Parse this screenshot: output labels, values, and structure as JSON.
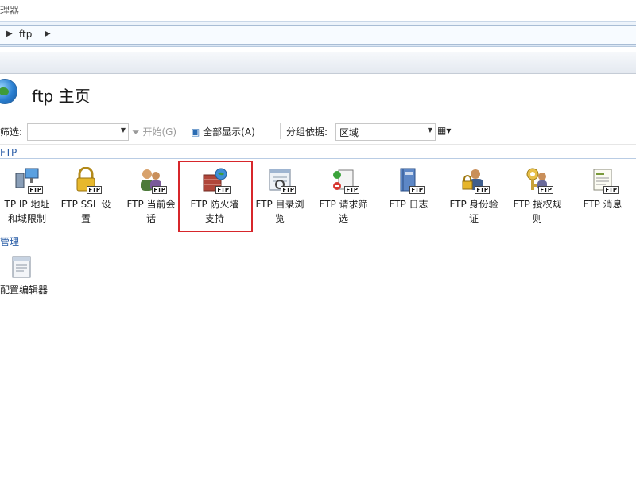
{
  "window": {
    "title_fragment": "理器"
  },
  "address": {
    "path": [
      "ftp"
    ]
  },
  "header": {
    "title": "ftp 主页"
  },
  "toolbar": {
    "filter_label": "筛选:",
    "filter_value": "",
    "start_label": "开始(G)",
    "show_all_label": "全部显示(A)",
    "group_by_label": "分组依据:",
    "group_by_value": "区域"
  },
  "sections": [
    {
      "label": "FTP"
    },
    {
      "label": "管理"
    }
  ],
  "ftp_features": [
    {
      "label": "TP IP 地址\n和域限制",
      "icon": "ip-restriction-icon"
    },
    {
      "label": "FTP SSL 设\n置",
      "icon": "ssl-lock-icon"
    },
    {
      "label": "FTP 当前会\n话",
      "icon": "sessions-icon"
    },
    {
      "label": "FTP 防火墙\n支持",
      "icon": "firewall-icon",
      "selected": true
    },
    {
      "label": "FTP 目录浏\n览",
      "icon": "directory-browsing-icon"
    },
    {
      "label": "FTP 请求筛\n选",
      "icon": "request-filtering-icon"
    },
    {
      "label": "FTP 日志",
      "icon": "log-icon"
    },
    {
      "label": "FTP 身份验\n证",
      "icon": "authentication-icon"
    },
    {
      "label": "FTP 授权规\n则",
      "icon": "authorization-icon"
    },
    {
      "label": "FTP 消息",
      "icon": "messages-icon"
    }
  ],
  "management_features": [
    {
      "label": "配置编辑器",
      "icon": "config-editor-icon"
    }
  ],
  "colors": {
    "selection_border": "#d7262b",
    "section_text": "#2c5fa8"
  }
}
